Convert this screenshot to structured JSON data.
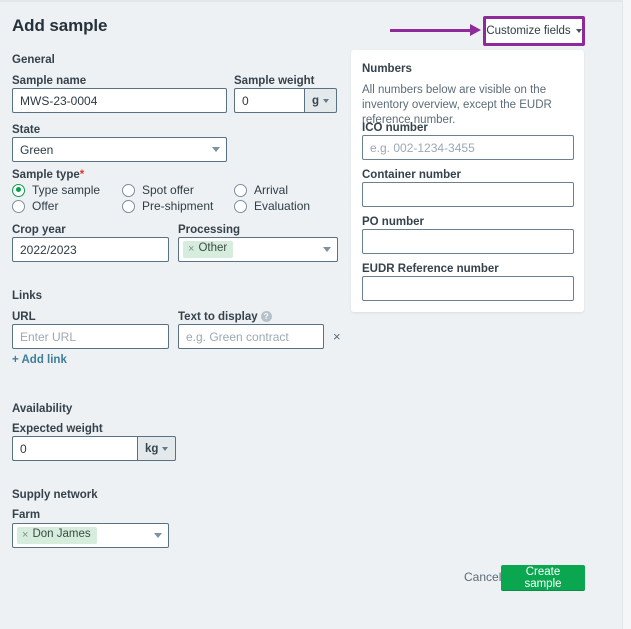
{
  "page": {
    "title": "Add sample"
  },
  "toolbar": {
    "customize_fields_label": "Customize fields"
  },
  "general": {
    "heading": "General",
    "sample_name_label": "Sample name",
    "sample_name_value": "MWS-23-0004",
    "sample_weight_label": "Sample weight",
    "sample_weight_value": "0",
    "sample_weight_unit": "g",
    "state_label": "State",
    "state_value": "Green",
    "sample_type_label": "Sample type",
    "sample_type_required_marker": "*",
    "sample_type_options": [
      {
        "label": "Type sample",
        "selected": true
      },
      {
        "label": "Spot offer",
        "selected": false
      },
      {
        "label": "Arrival",
        "selected": false
      },
      {
        "label": "Offer",
        "selected": false
      },
      {
        "label": "Pre-shipment",
        "selected": false
      },
      {
        "label": "Evaluation",
        "selected": false
      }
    ],
    "crop_year_label": "Crop year",
    "crop_year_value": "2022/2023",
    "processing_label": "Processing",
    "processing_tag": "Other",
    "tag_remove_glyph": "×"
  },
  "links": {
    "heading": "Links",
    "url_label": "URL",
    "url_placeholder": "Enter URL",
    "url_value": "",
    "text_label": "Text to display",
    "text_placeholder": "e.g. Green contract",
    "text_value": "",
    "info_glyph": "?",
    "remove_glyph": "×",
    "add_link_label": "+ Add link"
  },
  "availability": {
    "heading": "Availability",
    "expected_weight_label": "Expected weight",
    "expected_weight_value": "0",
    "expected_weight_unit": "kg"
  },
  "supply_network": {
    "heading": "Supply network",
    "farm_label": "Farm",
    "farm_tag": "Don James",
    "tag_remove_glyph": "×"
  },
  "numbers_card": {
    "title": "Numbers",
    "description": "All numbers below are visible on the inventory overview, except the EUDR reference number.",
    "ico_label": "ICO number",
    "ico_placeholder": "e.g. 002-1234-3455",
    "ico_value": "",
    "container_label": "Container number",
    "container_value": "",
    "po_label": "PO number",
    "po_value": "",
    "eudr_label": "EUDR Reference number",
    "eudr_value": ""
  },
  "footer": {
    "cancel_label": "Cancel",
    "create_label": "Create sample"
  },
  "colors": {
    "background": "#eef1f3",
    "accent_green": "#0aa750",
    "annotation_purple": "#8e2a99",
    "tag_green": "#d6ecdc",
    "required_red": "#e4352b"
  }
}
